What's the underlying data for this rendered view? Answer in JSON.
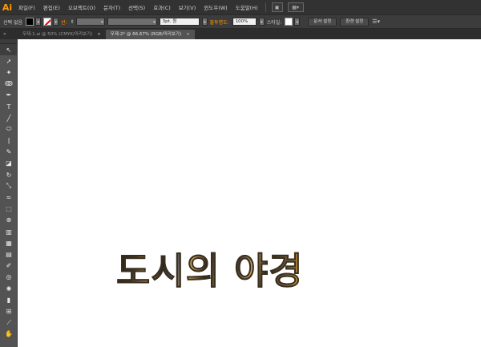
{
  "app": {
    "logo": "Ai",
    "menu": [
      "파일(F)",
      "편집(E)",
      "오브젝트(O)",
      "문자(T)",
      "선택(S)",
      "효과(C)",
      "보기(V)",
      "윈도우(W)",
      "도움말(H)"
    ]
  },
  "controlbar": {
    "selection_label": "선택 없음",
    "stroke_label": "선:",
    "stroke_profile": "3pt. 원",
    "opacity_label": "불투명도:",
    "opacity_value": "100%",
    "style_label": "스타일:",
    "doc_setup_button": "문서 설정",
    "prefs_button": "환경 설정"
  },
  "tabs": [
    {
      "label": "무제-1.ai @ 50% (CMYK/미리보기)",
      "close": "×",
      "active": false
    },
    {
      "label": "무제-2* @ 66.67% (RGB/미리보기)",
      "close": "×",
      "active": true
    }
  ],
  "tools": [
    "selection-icon",
    "direct-selection-icon",
    "magic-wand-icon",
    "lasso-icon",
    "pen-icon",
    "type-icon",
    "line-icon",
    "ellipse-icon",
    "paintbrush-icon",
    "pencil-icon",
    "eraser-icon",
    "rotate-icon",
    "scale-icon",
    "width-icon",
    "free-transform-icon",
    "shape-builder-icon",
    "perspective-grid-icon",
    "mesh-icon",
    "gradient-icon",
    "eyedropper-icon",
    "blend-icon",
    "symbol-sprayer-icon",
    "column-graph-icon",
    "artboard-icon",
    "slice-icon",
    "hand-icon"
  ],
  "canvas": {
    "artwork_text": "도시의 야경"
  },
  "colors": {
    "menubar": "#323232",
    "controlbar": "#3c3c3c",
    "panel": "#535353",
    "accent": "#ff9a00",
    "artboard": "#ffffff"
  }
}
